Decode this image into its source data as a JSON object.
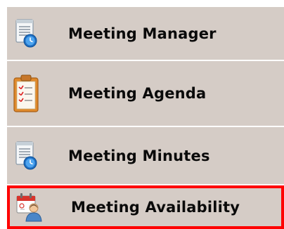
{
  "menu": {
    "items": [
      {
        "label": "Meeting Manager",
        "icon": "calendar-clock-icon",
        "selected": false
      },
      {
        "label": "Meeting Agenda",
        "icon": "clipboard-checklist-icon",
        "selected": false
      },
      {
        "label": "Meeting Minutes",
        "icon": "calendar-clock-icon",
        "selected": false
      },
      {
        "label": "Meeting Availability",
        "icon": "calendar-person-icon",
        "selected": true
      }
    ]
  },
  "colors": {
    "menu_background": "#d5ccc6",
    "divider": "#ffffff",
    "selected_border": "#ff0000",
    "text": "#0a0a0a"
  }
}
